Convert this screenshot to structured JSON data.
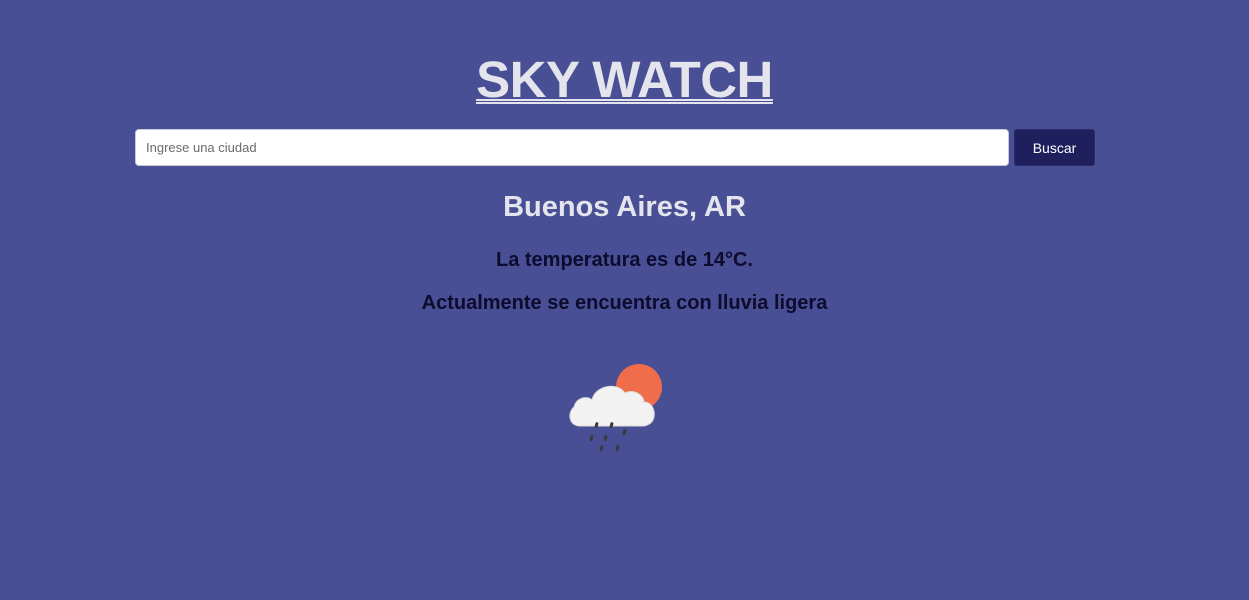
{
  "header": {
    "title": "SKY WATCH"
  },
  "search": {
    "placeholder": "Ingrese una ciudad",
    "value": "",
    "button_label": "Buscar"
  },
  "weather": {
    "city": "Buenos Aires, AR",
    "temperature_text": "La temperatura es de 14°C.",
    "description_text": "Actualmente se encuentra con lluvia ligera",
    "icon": "cloud-sun-rain-icon"
  },
  "colors": {
    "background": "#494f94",
    "button": "#1f1f5e",
    "sun": "#ef6d4b",
    "cloud": "#f2f2f2",
    "rain": "#3a3a3a"
  }
}
